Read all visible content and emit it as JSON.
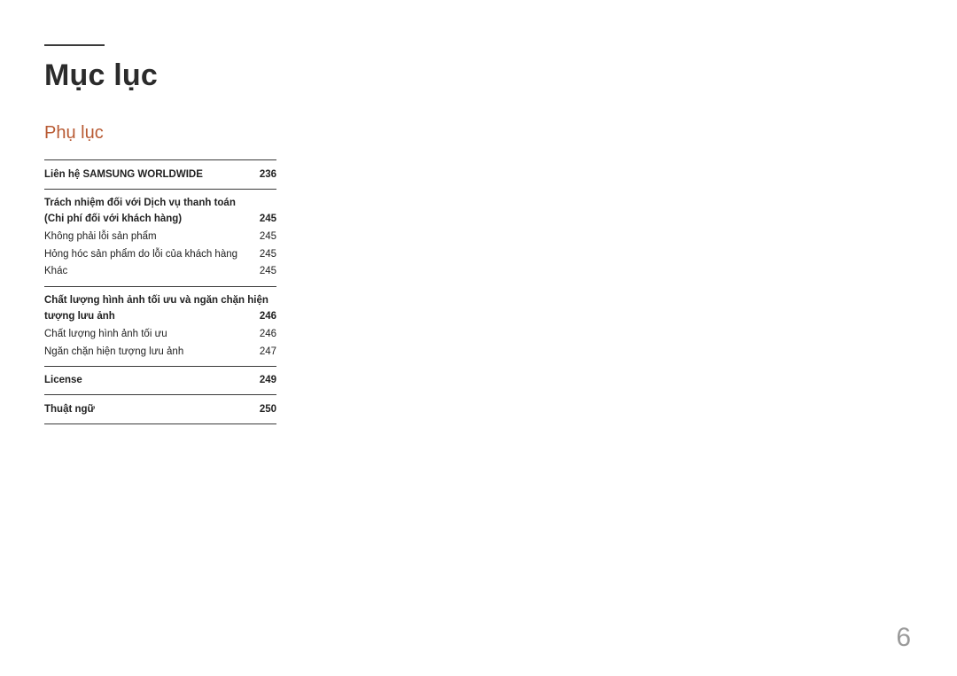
{
  "title": "Mục lục",
  "section": "Phụ lục",
  "pageNumber": "6",
  "toc": {
    "contactLabel": "Liên hệ SAMSUNG WORLDWIDE",
    "contactPage": "236",
    "liabilityLine1": "Trách nhiệm đối với Dịch vụ thanh toán",
    "liabilityLine2": "(Chi phí đối với khách hàng)",
    "liabilityPage": "245",
    "item1Label": "Không phải lỗi sản phẩm",
    "item1Page": "245",
    "item2Label": "Hỏng hóc sản phẩm do lỗi của khách hàng",
    "item2Page": "245",
    "item3Label": "Khác",
    "item3Page": "245",
    "optimalLine1": "Chất lượng hình ảnh tối ưu và ngăn chặn hiện",
    "optimalLine2": "tượng lưu ảnh",
    "optimalPage": "246",
    "item4Label": "Chất lượng hình ảnh tối ưu",
    "item4Page": "246",
    "item5Label": "Ngăn chặn hiện tượng lưu ảnh",
    "item5Page": "247",
    "licenseLabel": "License",
    "licensePage": "249",
    "glossaryLabel": "Thuật ngữ",
    "glossaryPage": "250"
  }
}
